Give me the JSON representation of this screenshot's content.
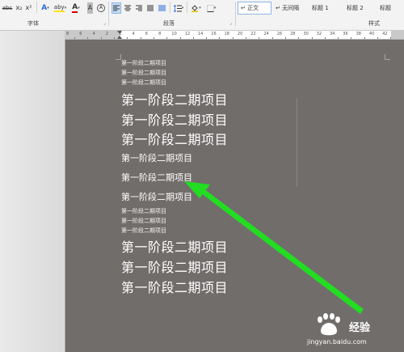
{
  "ribbon": {
    "font_group_label": "字体",
    "paragraph_group_label": "段落",
    "styles_group_label": "样式",
    "font_buttons": [
      "abc",
      "x₂",
      "x²",
      "A",
      "aby",
      "A",
      "A",
      "A"
    ],
    "styles": [
      {
        "label": "↵ 正文",
        "selected": true
      },
      {
        "label": "↵ 无间隔",
        "selected": false
      },
      {
        "label": "标题 1",
        "selected": false
      },
      {
        "label": "标题 2",
        "selected": false
      },
      {
        "label": "标题",
        "selected": false
      }
    ]
  },
  "ruler": {
    "ticks": [
      "8",
      "6",
      "4",
      "2",
      "2",
      "4",
      "6",
      "8",
      "10",
      "12",
      "14",
      "16",
      "18",
      "20",
      "22",
      "24",
      "26",
      "28",
      "30",
      "32",
      "34",
      "36",
      "38",
      "40",
      "42"
    ]
  },
  "document": {
    "lines": [
      {
        "text": "第一阶段二期项目",
        "size": "s"
      },
      {
        "text": "第一阶段二期项目",
        "size": "s"
      },
      {
        "text": "第一阶段二期项目",
        "size": "s"
      },
      {
        "text": "第一阶段二期项目",
        "size": "l"
      },
      {
        "text": "第一阶段二期项目",
        "size": "l"
      },
      {
        "text": "第一阶段二期项目",
        "size": "l"
      },
      {
        "text": "第一阶段二期项目",
        "size": "m"
      },
      {
        "text": "第一阶段二期项目",
        "size": "m"
      },
      {
        "text": "第一阶段二期项目",
        "size": "m"
      },
      {
        "text": "第一阶段二期项目",
        "size": "s"
      },
      {
        "text": "第一阶段二期项目",
        "size": "s"
      },
      {
        "text": "第一阶段二期项目",
        "size": "s"
      },
      {
        "text": "第一阶段二期项目",
        "size": "l"
      },
      {
        "text": "第一阶段二期项目",
        "size": "l"
      },
      {
        "text": "第一阶段二期项目",
        "size": "l"
      }
    ]
  },
  "watermark": {
    "brand": "经验",
    "url": "jingyan.baidu.com"
  },
  "colors": {
    "canvas": "#716d6b",
    "arrow": "#22dd22",
    "ribbon": "#f3f3f3"
  }
}
